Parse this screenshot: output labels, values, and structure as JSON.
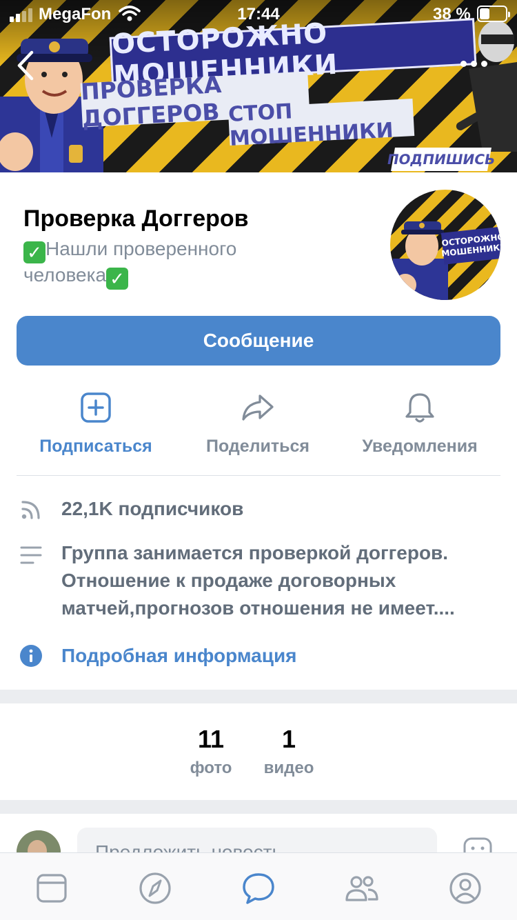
{
  "status_bar": {
    "carrier": "MegaFon",
    "time": "17:44",
    "battery": "38 %",
    "battery_level": 0.38,
    "icons": [
      "signal-icon",
      "wifi-icon",
      "battery-icon"
    ]
  },
  "cover": {
    "headline": "ОСТОРОЖНО МОШЕННИКИ",
    "line1": "ПРОВЕРКА ДОГГЕРОВ",
    "line2": "СТОП МОШЕННИКИ",
    "subscribe_tag": "ПОДПИШИСЬ",
    "back_icon": "chevron-left-icon",
    "more_icon": "more-dots-icon"
  },
  "profile": {
    "name": "Проверка Доггеров",
    "status_emoji": "✓",
    "status_text": "Нашли проверенного человека",
    "avatar_text_line1": "ОСТОРОЖНО",
    "avatar_text_line2": "МОШЕННИКИ"
  },
  "message_button": {
    "label": "Сообщение"
  },
  "actions": [
    {
      "label": "Подписаться",
      "icon": "add-square-icon",
      "color": "#4a86cc"
    },
    {
      "label": "Поделиться",
      "icon": "share-arrow-icon",
      "color": "#818c99"
    },
    {
      "label": "Уведомления",
      "icon": "bell-icon",
      "color": "#818c99"
    }
  ],
  "info": {
    "subscribers": "22,1K подписчиков",
    "description": "Группа занимается проверкой доггеров. Отношение к продаже договорных матчей,прогнозов отношения не имеет....",
    "more_info": "Подробная информация"
  },
  "counters": [
    {
      "num": "11",
      "caption": "фото"
    },
    {
      "num": "1",
      "caption": "видео"
    }
  ],
  "suggest": {
    "placeholder": "Предложить новость"
  },
  "tabbar": {
    "tabs": [
      "feed-icon",
      "explore-compass-icon",
      "messages-icon",
      "friends-icon",
      "profile-icon"
    ],
    "active_index": 2
  },
  "colors": {
    "accent": "#4a86cc",
    "secondary": "#818c99",
    "text": "#000000",
    "separator": "#ebedf0"
  }
}
